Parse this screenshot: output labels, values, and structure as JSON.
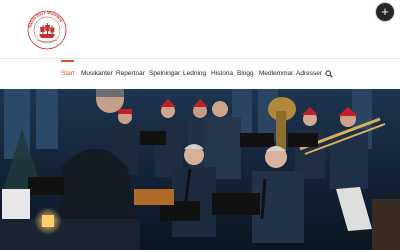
{
  "logo": {
    "ring_text": "Bålsta Dåre Musiskår",
    "brand_red": "#c8302b"
  },
  "header": {
    "add_button_label": "+"
  },
  "nav": {
    "accent": "#e2502a",
    "items": [
      {
        "label": "Start",
        "active": true
      },
      {
        "label": "Musikanter"
      },
      {
        "label": "Repertoar"
      },
      {
        "label": "Spelningar"
      },
      {
        "label": "Ledning"
      },
      {
        "label": "Historia"
      },
      {
        "label": "Blogg"
      },
      {
        "label": "Medlemmar"
      },
      {
        "label": "Adresser"
      }
    ],
    "search_icon": "search-icon"
  },
  "hero": {
    "icon": "band-photo"
  }
}
